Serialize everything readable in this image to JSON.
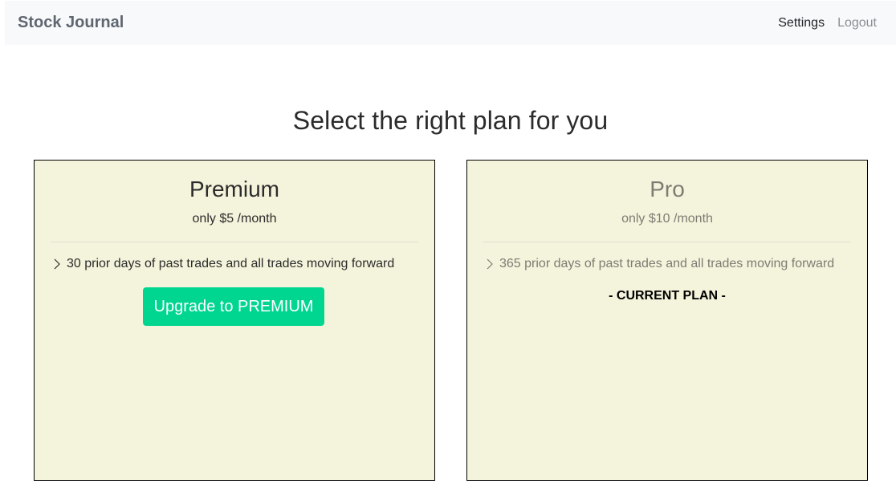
{
  "navbar": {
    "brand": "Stock Journal",
    "settings_label": "Settings",
    "logout_label": "Logout"
  },
  "page": {
    "title": "Select the right plan for you"
  },
  "plans": [
    {
      "name": "Premium",
      "price": "only $5 /month",
      "feature": "30 prior days of past trades and all trades moving forward",
      "action_label": "Upgrade to PREMIUM"
    },
    {
      "name": "Pro",
      "price": "only $10 /month",
      "feature": "365 prior days of past trades and all trades moving forward",
      "status_label": "- CURRENT PLAN -"
    }
  ],
  "colors": {
    "navbar_bg": "#f8f9fa",
    "card_bg": "#f4f4dc",
    "accent_button": "#00d68f",
    "muted_text": "#7c7c74"
  },
  "icons": {
    "feature_bullet": "chevron-right-icon"
  }
}
